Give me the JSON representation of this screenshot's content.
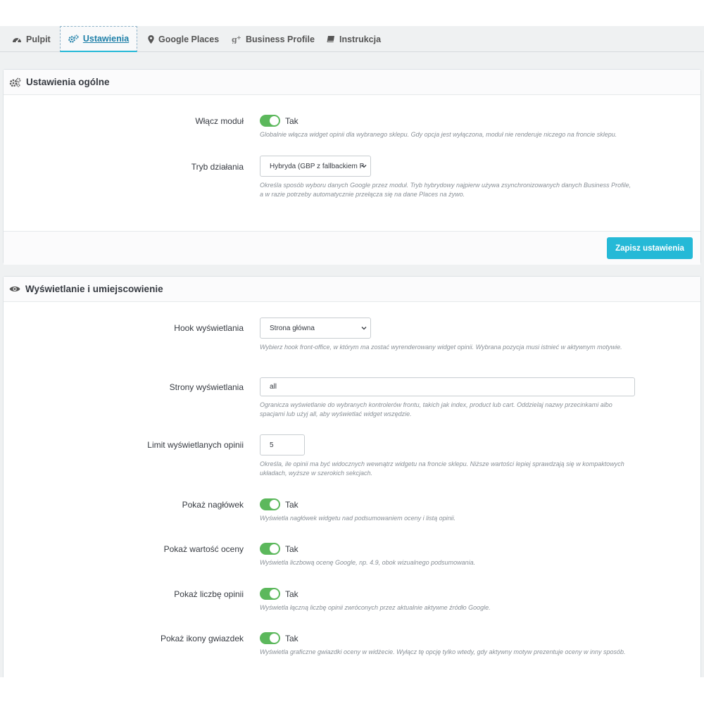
{
  "tabs": [
    {
      "label": "Pulpit",
      "icon": "dashboard-icon"
    },
    {
      "label": "Ustawienia",
      "icon": "cogs-icon",
      "active": true
    },
    {
      "label": "Google Places",
      "icon": "map-marker-icon"
    },
    {
      "label": "Business Profile",
      "icon": "google-plus-icon"
    },
    {
      "label": "Instrukcja",
      "icon": "book-icon"
    }
  ],
  "general": {
    "title": "Ustawienia ogólne",
    "enable_module": {
      "label": "Włącz moduł",
      "value": "Tak",
      "help": "Globalnie włącza widget opinii dla wybranego sklepu. Gdy opcja jest wyłączona, moduł nie renderuje niczego na froncie sklepu."
    },
    "mode": {
      "label": "Tryb działania",
      "value": "Hybryda (GBP z fallbackiem P",
      "help": "Określa sposób wyboru danych Google przez moduł. Tryb hybrydowy najpierw używa zsynchronizowanych danych Business Profile, a w razie potrzeby automatycznie przełącza się na dane Places na żywo."
    },
    "save_label": "Zapisz ustawienia"
  },
  "display": {
    "title": "Wyświetlanie i umiejscowienie",
    "hook": {
      "label": "Hook wyświetlania",
      "value": "Strona główna",
      "help": "Wybierz hook front-office, w którym ma zostać wyrenderowany widget opinii. Wybrana pozycja musi istnieć w aktywnym motywie."
    },
    "pages": {
      "label": "Strony wyświetlania",
      "value": "all",
      "help": "Ogranicza wyświetlanie do wybranych kontrolerów frontu, takich jak index, product lub cart. Oddzielaj nazwy przecinkami albo spacjami lub użyj all, aby wyświetlać widget wszędzie."
    },
    "limit": {
      "label": "Limit wyświetlanych opinii",
      "value": "5",
      "help": "Określa, ile opinii ma być widocznych wewnątrz widgetu na froncie sklepu. Niższe wartości lepiej sprawdzają się w kompaktowych układach, wyższe w szerokich sekcjach."
    },
    "show_header": {
      "label": "Pokaż nagłówek",
      "value": "Tak",
      "help": "Wyświetla nagłówek widgetu nad podsumowaniem oceny i listą opinii."
    },
    "show_rating": {
      "label": "Pokaż wartość oceny",
      "value": "Tak",
      "help": "Wyświetla liczbową ocenę Google, np. 4.9, obok wizualnego podsumowania."
    },
    "show_count": {
      "label": "Pokaż liczbę opinii",
      "value": "Tak",
      "help": "Wyświetla łączną liczbę opinii zwróconych przez aktualnie aktywne źródło Google."
    },
    "show_stars": {
      "label": "Pokaż ikony gwiazdek",
      "value": "Tak",
      "help": "Wyświetla graficzne gwiazdki oceny w widżecie. Wyłącz tę opcję tylko wtedy, gdy aktywny motyw prezentuje oceny w inny sposób."
    }
  },
  "colors": {
    "accent": "#25b9d7",
    "toggle_on": "#5cb85c"
  }
}
